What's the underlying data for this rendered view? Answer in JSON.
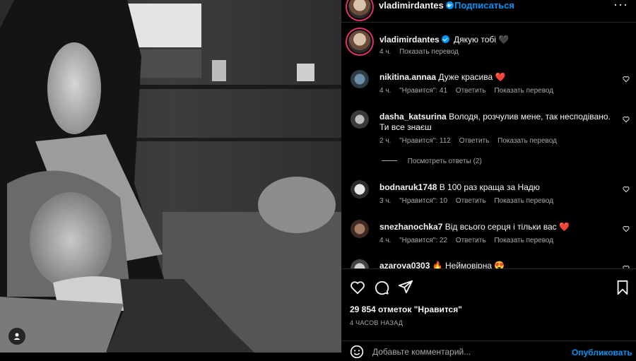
{
  "header": {
    "username": "vladimirdantes",
    "separator": "•",
    "follow_label": "Подписаться",
    "more_label": "···"
  },
  "caption": {
    "username": "vladimirdantes",
    "text": "Дякую тобі 🖤",
    "time": "4 ч.",
    "translate": "Показать перевод"
  },
  "comments": [
    {
      "username": "nikitina.annaa",
      "text": "Дуже красива ❤️",
      "time": "4 ч.",
      "likes": "\"Нравится\": 41",
      "reply": "Ответить",
      "translate": "Показать перевод"
    },
    {
      "username": "dasha_katsurina",
      "text": "Володя, розчулив мене, так несподівано. Ти все знаєш",
      "time": "2 ч.",
      "likes": "\"Нравится\": 112",
      "reply": "Ответить",
      "translate": "Показать перевод",
      "view_replies": "Посмотреть ответы (2)"
    },
    {
      "username": "bodnaruk1748",
      "text": "В 100 раз краща за Надю",
      "time": "3 ч.",
      "likes": "\"Нравится\": 10",
      "reply": "Ответить",
      "translate": "Показать перевод"
    },
    {
      "username": "snezhanochka7",
      "text": "Від всього серця і тільки вас ❤️",
      "time": "4 ч.",
      "likes": "\"Нравится\": 22",
      "reply": "Ответить",
      "translate": "Показать перевод"
    },
    {
      "username": "azarova0303",
      "text": "🔥 Неймовірна 😍"
    }
  ],
  "actions": {
    "like_icon": "heart-icon",
    "comment_icon": "comment-icon",
    "share_icon": "paper-plane-icon",
    "save_icon": "bookmark-icon"
  },
  "likes_text": "29 854 отметок \"Нравится\"",
  "time_ago": "4 ЧАСОВ НАЗАД",
  "composer": {
    "placeholder": "Добавьте комментарий...",
    "post_label": "Опубликовать"
  },
  "colors": {
    "accent": "#0095f6",
    "background": "#000000",
    "secondary_text": "#a8a8a8",
    "heart_red": "#ff3040"
  }
}
